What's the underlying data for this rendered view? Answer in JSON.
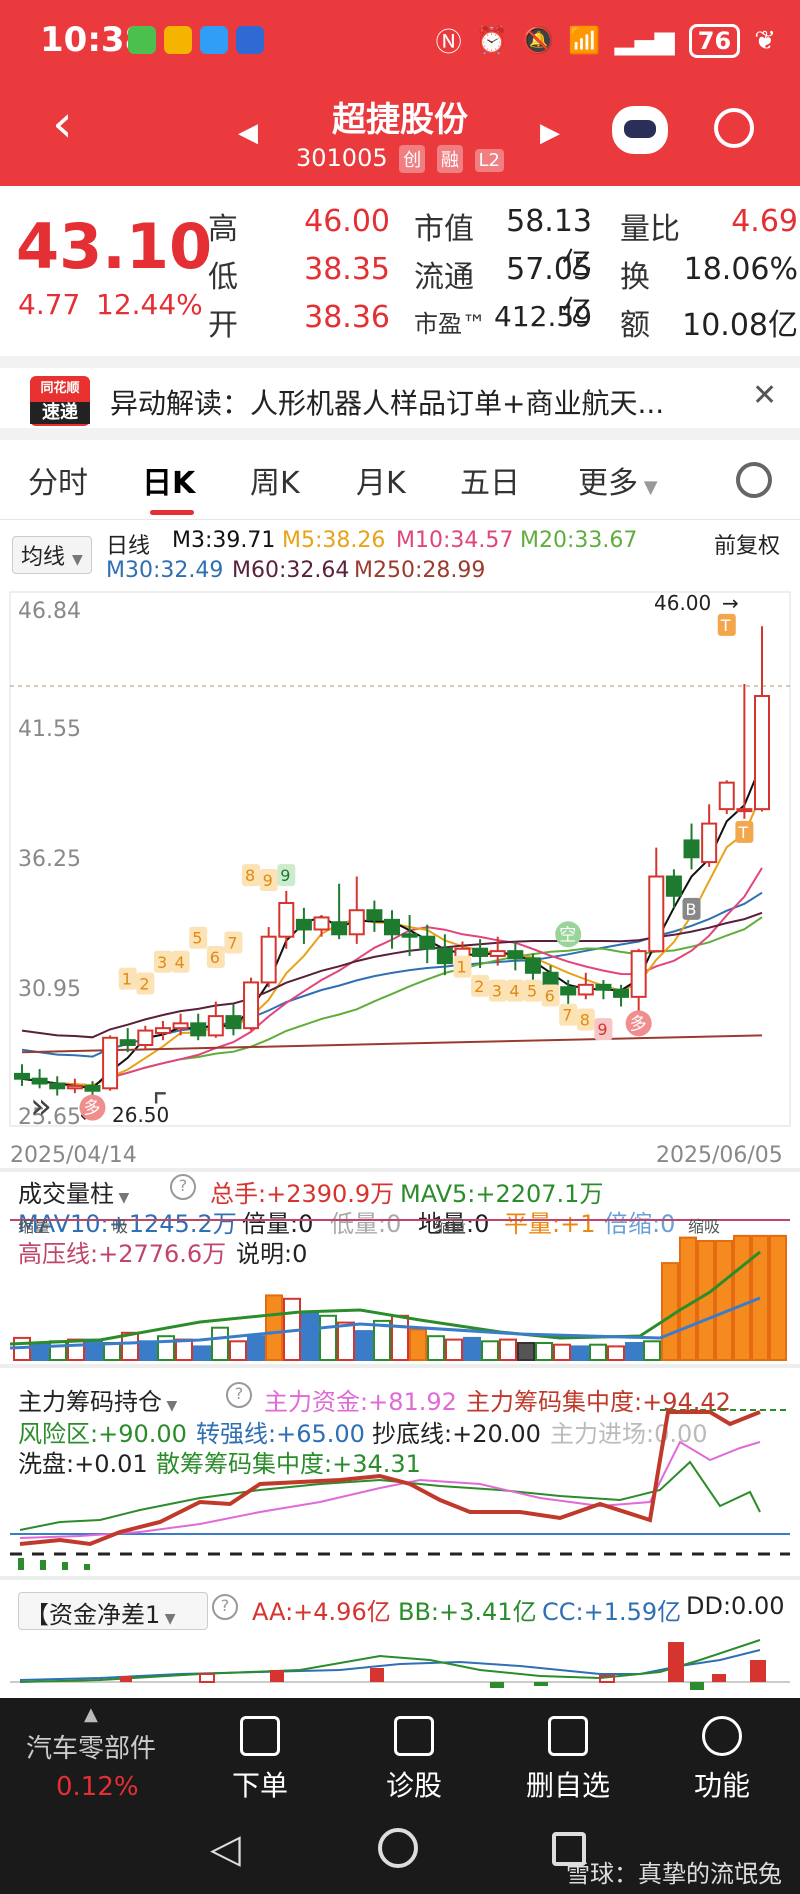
{
  "status_bar": {
    "time": "10:38",
    "battery": "76"
  },
  "header": {
    "title": "超捷股份",
    "code": "301005",
    "tags": [
      "创",
      "融",
      "L2"
    ]
  },
  "quote": {
    "price": "43.10",
    "change": "4.77",
    "change_pct": "12.44%",
    "labels": {
      "high": "高",
      "low": "低",
      "open": "开",
      "mktcap": "市值",
      "float": "流通",
      "pe": "市盈™",
      "vol_ratio": "量比",
      "turnover": "换",
      "amount": "额"
    },
    "high": "46.00",
    "low": "38.35",
    "open": "38.36",
    "mktcap": "58.13亿",
    "float": "57.05亿",
    "pe": "412.59",
    "vol_ratio": "4.69",
    "turnover": "18.06%",
    "amount": "10.08亿"
  },
  "news": {
    "logo_top": "同花顺",
    "logo_bottom": "速递",
    "text": "异动解读：人形机器人样品订单+商业航天..."
  },
  "tabs": [
    "分时",
    "日K",
    "周K",
    "月K",
    "五日",
    "更多"
  ],
  "ma": {
    "selector": "均线",
    "period": "日线",
    "m3": "M3:39.71",
    "m5": "M5:38.26",
    "m10": "M10:34.57",
    "m20": "M20:33.67",
    "m30": "M30:32.49",
    "m60": "M60:32.64",
    "m250": "M250:28.99",
    "adjust": "前复权",
    "colors": {
      "m3": "#111111",
      "m5": "#e7a318",
      "m10": "#e2457b",
      "m20": "#5fae3c",
      "m30": "#2f6fb3",
      "m60": "#5a1f3a",
      "m250": "#9b3b2f"
    }
  },
  "kchart": {
    "y_ticks": [
      "46.84",
      "41.55",
      "36.25",
      "30.95",
      "25.65"
    ],
    "max_label": "46.00",
    "min_label": "26.50",
    "date_start": "2025/04/14",
    "date_end": "2025/06/05",
    "counters": [
      "1",
      "2",
      "3",
      "4",
      "5",
      "6",
      "7",
      "8",
      "9",
      "1",
      "2",
      "3",
      "4",
      "5",
      "6",
      "7",
      "8",
      "9"
    ],
    "signals": {
      "empty": "空",
      "buy": "多",
      "b": "B",
      "t": "T"
    },
    "candles": [
      {
        "o": 27.4,
        "c": 27.2,
        "h": 27.8,
        "l": 26.9
      },
      {
        "o": 27.2,
        "c": 27.0,
        "h": 27.6,
        "l": 26.8
      },
      {
        "o": 27.0,
        "c": 26.8,
        "h": 27.3,
        "l": 26.5
      },
      {
        "o": 26.8,
        "c": 26.9,
        "h": 27.2,
        "l": 26.6
      },
      {
        "o": 26.9,
        "c": 26.7,
        "h": 27.1,
        "l": 26.5
      },
      {
        "o": 26.8,
        "c": 28.9,
        "h": 29.0,
        "l": 26.7
      },
      {
        "o": 28.8,
        "c": 28.6,
        "h": 29.3,
        "l": 28.3
      },
      {
        "o": 28.6,
        "c": 29.2,
        "h": 29.4,
        "l": 28.4
      },
      {
        "o": 29.1,
        "c": 29.3,
        "h": 29.6,
        "l": 28.8
      },
      {
        "o": 29.3,
        "c": 29.5,
        "h": 29.9,
        "l": 29.0
      },
      {
        "o": 29.5,
        "c": 29.0,
        "h": 29.9,
        "l": 28.8
      },
      {
        "o": 29.0,
        "c": 29.8,
        "h": 30.4,
        "l": 28.9
      },
      {
        "o": 29.8,
        "c": 29.3,
        "h": 30.3,
        "l": 29.0
      },
      {
        "o": 29.3,
        "c": 31.2,
        "h": 31.4,
        "l": 29.2
      },
      {
        "o": 31.2,
        "c": 33.1,
        "h": 33.5,
        "l": 31.0
      },
      {
        "o": 33.1,
        "c": 34.5,
        "h": 35.0,
        "l": 32.6
      },
      {
        "o": 33.8,
        "c": 33.4,
        "h": 34.3,
        "l": 32.8
      },
      {
        "o": 33.4,
        "c": 33.9,
        "h": 34.0,
        "l": 33.1
      },
      {
        "o": 33.7,
        "c": 33.2,
        "h": 35.3,
        "l": 33.0
      },
      {
        "o": 33.2,
        "c": 34.2,
        "h": 35.6,
        "l": 32.8
      },
      {
        "o": 34.2,
        "c": 33.8,
        "h": 34.6,
        "l": 33.3
      },
      {
        "o": 33.8,
        "c": 33.2,
        "h": 34.2,
        "l": 32.6
      },
      {
        "o": 33.2,
        "c": 33.1,
        "h": 34.0,
        "l": 32.3
      },
      {
        "o": 33.1,
        "c": 32.6,
        "h": 33.6,
        "l": 32.0
      },
      {
        "o": 32.6,
        "c": 32.0,
        "h": 33.2,
        "l": 31.5
      },
      {
        "o": 32.0,
        "c": 32.6,
        "h": 32.9,
        "l": 31.6
      },
      {
        "o": 32.6,
        "c": 32.3,
        "h": 33.0,
        "l": 31.8
      },
      {
        "o": 32.3,
        "c": 32.5,
        "h": 33.1,
        "l": 31.9
      },
      {
        "o": 32.5,
        "c": 32.2,
        "h": 32.9,
        "l": 31.7
      },
      {
        "o": 32.2,
        "c": 31.6,
        "h": 32.4,
        "l": 31.0
      },
      {
        "o": 31.6,
        "c": 31.0,
        "h": 31.9,
        "l": 30.4
      },
      {
        "o": 31.0,
        "c": 30.7,
        "h": 31.3,
        "l": 30.2
      },
      {
        "o": 30.7,
        "c": 31.1,
        "h": 31.6,
        "l": 30.5
      },
      {
        "o": 31.1,
        "c": 30.9,
        "h": 31.3,
        "l": 30.5
      },
      {
        "o": 30.9,
        "c": 30.6,
        "h": 31.1,
        "l": 30.2
      },
      {
        "o": 30.6,
        "c": 32.5,
        "h": 32.6,
        "l": 30.0
      },
      {
        "o": 32.5,
        "c": 35.6,
        "h": 36.8,
        "l": 32.5
      },
      {
        "o": 35.6,
        "c": 34.8,
        "h": 35.9,
        "l": 34.3
      },
      {
        "o": 37.1,
        "c": 36.4,
        "h": 37.8,
        "l": 35.9
      },
      {
        "o": 36.2,
        "c": 37.8,
        "h": 38.6,
        "l": 36.0
      },
      {
        "o": 38.4,
        "c": 39.5,
        "h": 39.6,
        "l": 38.2
      },
      {
        "o": 38.4,
        "c": 38.4,
        "h": 43.6,
        "l": 38.0
      },
      {
        "o": 38.4,
        "c": 43.1,
        "h": 46.0,
        "l": 38.3
      }
    ]
  },
  "volume": {
    "title": "成交量柱",
    "total": "总手:+2390.9万",
    "mav5": "MAV5:+2207.1万",
    "mav10": "MAV10:+1245.2万",
    "bei": "倍量:0",
    "di": "低量:0",
    "dl": "地量:0",
    "ping": "平量:+1",
    "bs": "倍缩:0",
    "gaoya": "高压线:+2776.6万",
    "shuoming": "说明:0",
    "tags": [
      "吸",
      "缩量",
      "缩量",
      "缩吸",
      "天"
    ],
    "bars": [
      0.13,
      0.1,
      0.11,
      0.12,
      0.12,
      0.1,
      0.16,
      0.11,
      0.14,
      0.12,
      0.08,
      0.19,
      0.11,
      0.14,
      0.38,
      0.36,
      0.28,
      0.26,
      0.22,
      0.17,
      0.23,
      0.26,
      0.18,
      0.14,
      0.12,
      0.13,
      0.11,
      0.12,
      0.1,
      0.1,
      0.09,
      0.08,
      0.09,
      0.08,
      0.1,
      0.11,
      0.57,
      0.72,
      0.7,
      0.7,
      0.73,
      0.73,
      0.73
    ]
  },
  "chips": {
    "title": "主力筹码持仓",
    "main_fund": "主力资金:+81.92",
    "concentration": "主力筹码集中度:+94.42",
    "risk": "风险区:+90.00",
    "strong": "转强线:+65.00",
    "bottom": "抄底线:+20.00",
    "entry": "主力进场:0.00",
    "wash": "洗盘:+0.01",
    "scatter": "散筹筹码集中度:+34.31"
  },
  "fund": {
    "title": "【资金净差1",
    "aa": "AA:+4.96亿",
    "bb": "BB:+3.41亿",
    "cc": "CC:+1.59亿",
    "dd": "DD:0.00"
  },
  "footer": {
    "sector": "汽车零部件",
    "sector_pct": "0.12%",
    "buttons": [
      "下单",
      "诊股",
      "删自选",
      "功能"
    ],
    "watermark": "雪球：真挚的流氓兔"
  }
}
